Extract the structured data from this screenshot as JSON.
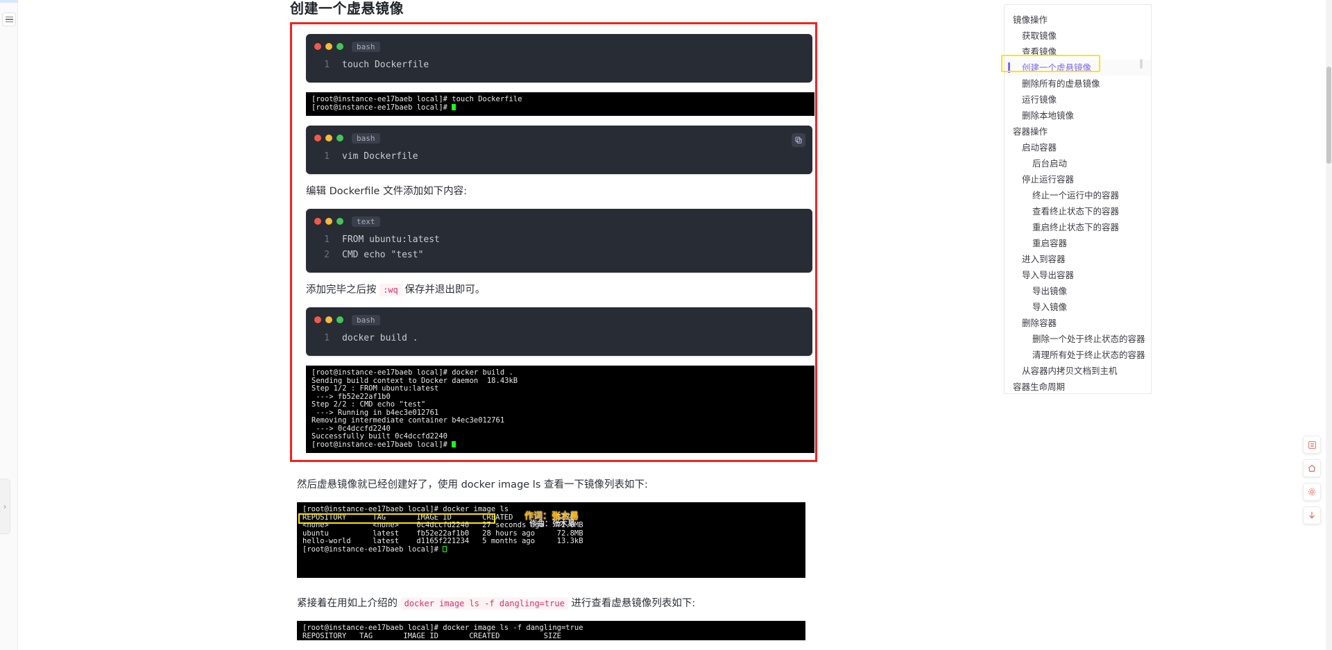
{
  "page": {
    "title": "创建一个虚悬镜像"
  },
  "left_rail": {
    "menu_icon": "hamburger-icon",
    "expand_icon": "chevron-right-icon"
  },
  "blocks": {
    "code1": {
      "lang": "bash",
      "lines": [
        {
          "no": "1",
          "text": "touch Dockerfile"
        }
      ]
    },
    "term1": {
      "lines": [
        "[root@instance-ee17baeb local]# touch Dockerfile",
        "[root@instance-ee17baeb local]# "
      ]
    },
    "code2": {
      "lang": "bash",
      "lines": [
        {
          "no": "1",
          "text": "vim Dockerfile"
        }
      ],
      "copy_label": "copy-icon"
    },
    "para1": "编辑 Dockerfile 文件添加如下内容:",
    "code3": {
      "lang": "text",
      "lines": [
        {
          "no": "1",
          "text": "FROM ubuntu:latest"
        },
        {
          "no": "2",
          "text": "CMD echo \"test\""
        }
      ]
    },
    "para2_before": "添加完毕之后按",
    "para2_code": ":wq",
    "para2_after": "保存并退出即可。",
    "code4": {
      "lang": "bash",
      "lines": [
        {
          "no": "1",
          "text": "docker build ."
        }
      ]
    },
    "term2": {
      "lines": [
        "[root@instance-ee17baeb local]# docker build .",
        "Sending build context to Docker daemon  18.43kB",
        "Step 1/2 : FROM ubuntu:latest",
        " ---> fb52e22af1b0",
        "Step 2/2 : CMD echo \"test\"",
        " ---> Running in b4ec3e012761",
        "Removing intermediate container b4ec3e012761",
        " ---> 0c4dccfd2240",
        "Successfully built 0c4dccfd2240",
        "[root@instance-ee17baeb local]# "
      ]
    },
    "para3": "然后虚悬镜像就已经创建好了，使用 docker image ls 查看一下镜像列表如下:",
    "term3": {
      "lines": [
        "[root@instance-ee17baeb local]# docker image ls",
        "REPOSITORY      TAG       IMAGE ID       CREATED          SIZE",
        "<none>          <none>    0c4dccfd2240   27 seconds ago   72.8MB",
        "ubuntu          latest    fb52e22af1b0   28 hours ago     72.8MB",
        "hello-world     latest    d1165f221234   5 months ago     13.3kB",
        "[root@instance-ee17baeb local]# "
      ]
    },
    "para4_before": "紧接着在用如上介绍的",
    "para4_code": "docker image ls -f dangling=true",
    "para4_after": "进行查看虚悬镜像列表如下:",
    "term4": {
      "lines": [
        "[root@instance-ee17baeb local]# docker image ls -f dangling=true",
        "REPOSITORY   TAG       IMAGE ID       CREATED          SIZE"
      ]
    },
    "watermark1": "作词：张木易",
    "watermark2": "作曲：张木易"
  },
  "toc": {
    "items": [
      {
        "label": "镜像操作",
        "level": 1,
        "active": false
      },
      {
        "label": "获取镜像",
        "level": 2,
        "active": false
      },
      {
        "label": "查看镜像",
        "level": 2,
        "active": false
      },
      {
        "label": "创建一个虚悬镜像",
        "level": 2,
        "active": true
      },
      {
        "label": "删除所有的虚悬镜像",
        "level": 2,
        "active": false
      },
      {
        "label": "运行镜像",
        "level": 2,
        "active": false
      },
      {
        "label": "删除本地镜像",
        "level": 2,
        "active": false
      },
      {
        "label": "容器操作",
        "level": 1,
        "active": false
      },
      {
        "label": "启动容器",
        "level": 2,
        "active": false
      },
      {
        "label": "后台启动",
        "level": 3,
        "active": false
      },
      {
        "label": "停止运行容器",
        "level": 2,
        "active": false
      },
      {
        "label": "终止一个运行中的容器",
        "level": 3,
        "active": false
      },
      {
        "label": "查看终止状态下的容器",
        "level": 3,
        "active": false
      },
      {
        "label": "重启终止状态下的容器",
        "level": 3,
        "active": false
      },
      {
        "label": "重启容器",
        "level": 3,
        "active": false
      },
      {
        "label": "进入到容器",
        "level": 2,
        "active": false
      },
      {
        "label": "导入导出容器",
        "level": 2,
        "active": false
      },
      {
        "label": "导出镜像",
        "level": 3,
        "active": false
      },
      {
        "label": "导入镜像",
        "level": 3,
        "active": false
      },
      {
        "label": "删除容器",
        "level": 2,
        "active": false
      },
      {
        "label": "删除一个处于终止状态的容器",
        "level": 3,
        "active": false
      },
      {
        "label": "清理所有处于终止状态的容器",
        "level": 3,
        "active": false
      },
      {
        "label": "从容器内拷贝文档到主机",
        "level": 2,
        "active": false
      },
      {
        "label": "容器生命周期",
        "level": 1,
        "active": false
      }
    ]
  },
  "fabs": [
    {
      "name": "toc-toggle",
      "glyph": "目"
    },
    {
      "name": "home",
      "glyph": "⌂"
    },
    {
      "name": "settings",
      "glyph": "⚙"
    },
    {
      "name": "scroll-to-bottom",
      "glyph": "↓"
    }
  ],
  "colors": {
    "accent": "#7a6cf0",
    "highlight_red": "#f4221f",
    "highlight_yellow": "#ffe500",
    "code_bg": "#282c34",
    "terminal_bg": "#000000"
  }
}
